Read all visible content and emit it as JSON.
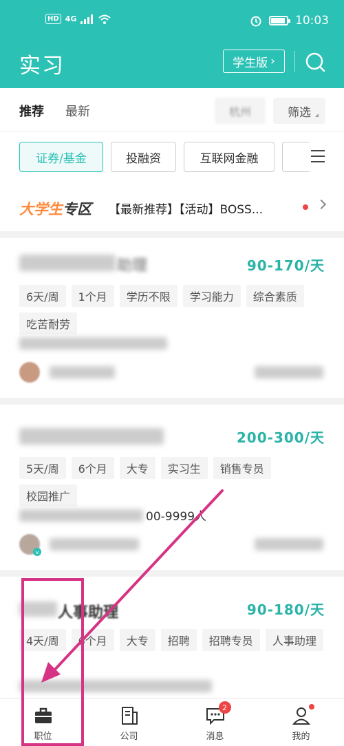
{
  "status_bar": {
    "network": "4G",
    "hd": "HD",
    "time": "10:03"
  },
  "header": {
    "title": "实习",
    "student_label": "学生版",
    "student_arrow": "›"
  },
  "tabs": {
    "recommend": "推荐",
    "latest": "最新",
    "city": "杭州",
    "filter": "筛选"
  },
  "categories": [
    "证券/基金",
    "投融资",
    "互联网金融",
    ""
  ],
  "banner": {
    "logo_a": "大学生",
    "logo_b": "专区",
    "text": "【最新推荐】【活动】BOSS..."
  },
  "jobs": [
    {
      "title": "助理",
      "salary": "90-170/天",
      "tags": [
        "6天/周",
        "1个月",
        "学历不限",
        "学习能力",
        "综合素质",
        "吃苦耐劳"
      ],
      "company": ""
    },
    {
      "title": "",
      "salary": "200-300/天",
      "tags": [
        "5天/周",
        "6个月",
        "大专",
        "实习生",
        "销售专员",
        "校园推广"
      ],
      "company": "00-9999人"
    },
    {
      "title": "人事助理",
      "salary": "90-180/天",
      "tags": [
        "4天/周",
        "6个月",
        "大专",
        "招聘",
        "招聘专员",
        "人事助理"
      ],
      "company": ""
    }
  ],
  "bottom_nav": [
    {
      "label": "职位"
    },
    {
      "label": "公司"
    },
    {
      "label": "消息",
      "badge": "2"
    },
    {
      "label": "我的"
    }
  ],
  "colors": {
    "brand": "#2bc1b5",
    "annotation": "#d63384"
  }
}
